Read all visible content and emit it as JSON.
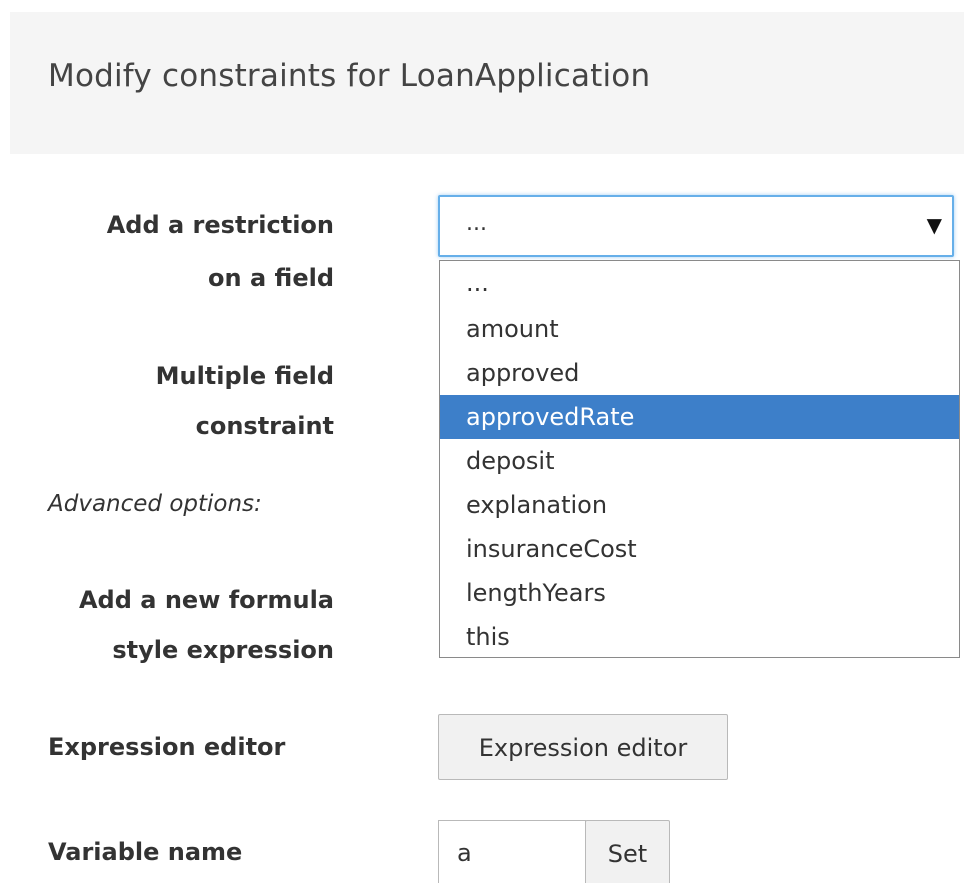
{
  "header": {
    "title": "Modify constraints for LoanApplication"
  },
  "form": {
    "restriction_label_line1": "Add a restriction",
    "restriction_label_line2": "on a field",
    "multiple_label_line1": "Multiple field",
    "multiple_label_line2": "constraint",
    "advanced_label": "Advanced options:",
    "formula_label_line1": "Add a new formula",
    "formula_label_line2": "style expression",
    "expression_editor_label": "Expression editor",
    "expression_editor_button": "Expression editor",
    "variable_name_label": "Variable name",
    "variable_name_value": "a",
    "set_button": "Set"
  },
  "field_select": {
    "selected_value": "...",
    "arrow_icon": "triangle-down-icon",
    "options": [
      "...",
      "amount",
      "approved",
      "approvedRate",
      "deposit",
      "explanation",
      "insuranceCost",
      "lengthYears",
      "this"
    ],
    "highlighted_option": "approvedRate"
  },
  "colors": {
    "highlight": "#3d7fc9",
    "focus_border": "#66afe9",
    "header_bg": "#f5f5f5"
  }
}
